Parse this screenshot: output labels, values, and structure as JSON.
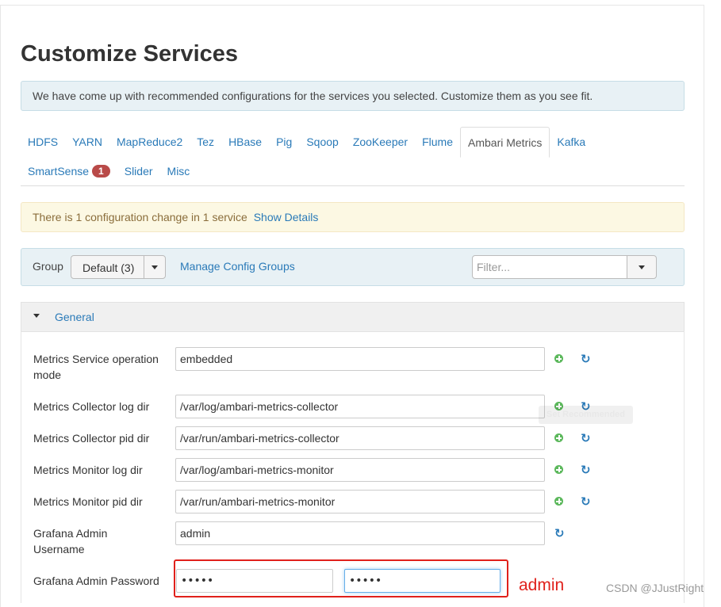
{
  "page": {
    "title": "Customize Services"
  },
  "info_alert": "We have come up with recommended configurations for the services you selected. Customize them as you see fit.",
  "tabs": [
    {
      "label": "HDFS"
    },
    {
      "label": "YARN"
    },
    {
      "label": "MapReduce2"
    },
    {
      "label": "Tez"
    },
    {
      "label": "HBase"
    },
    {
      "label": "Pig"
    },
    {
      "label": "Sqoop"
    },
    {
      "label": "ZooKeeper"
    },
    {
      "label": "Flume"
    },
    {
      "label": "Ambari Metrics",
      "active": true
    },
    {
      "label": "Kafka"
    },
    {
      "label": "SmartSense",
      "badge": "1"
    },
    {
      "label": "Slider"
    },
    {
      "label": "Misc"
    }
  ],
  "change_alert": {
    "text": "There is 1 configuration change in 1 service",
    "link": "Show Details"
  },
  "group_bar": {
    "label": "Group",
    "selected": "Default (3)",
    "manage_link": "Manage Config Groups",
    "filter_placeholder": "Filter..."
  },
  "section": {
    "title": "General"
  },
  "configs": [
    {
      "label": "Metrics Service operation mode",
      "value": "embedded"
    },
    {
      "label": "Metrics Collector log dir",
      "value": "/var/log/ambari-metrics-collector"
    },
    {
      "label": "Metrics Collector pid dir",
      "value": "/var/run/ambari-metrics-collector"
    },
    {
      "label": "Metrics Monitor log dir",
      "value": "/var/log/ambari-metrics-monitor"
    },
    {
      "label": "Metrics Monitor pid dir",
      "value": "/var/run/ambari-metrics-monitor"
    },
    {
      "label": "Grafana Admin Username",
      "value": "admin"
    },
    {
      "label": "Grafana Admin Password",
      "value": "•••••",
      "confirm_value": "•••••"
    }
  ],
  "tooltip": "Set Recommended",
  "annotation": "admin",
  "watermark": "CSDN @JJustRight",
  "colors": {
    "link": "#2a7ab8",
    "annotation": "#e0201b",
    "badge": "#b94a48",
    "add_icon": "#5cb85c"
  },
  "icons": {
    "add": "plus-circle-icon",
    "refresh": "refresh-icon",
    "dropdown": "caret-down-icon"
  }
}
